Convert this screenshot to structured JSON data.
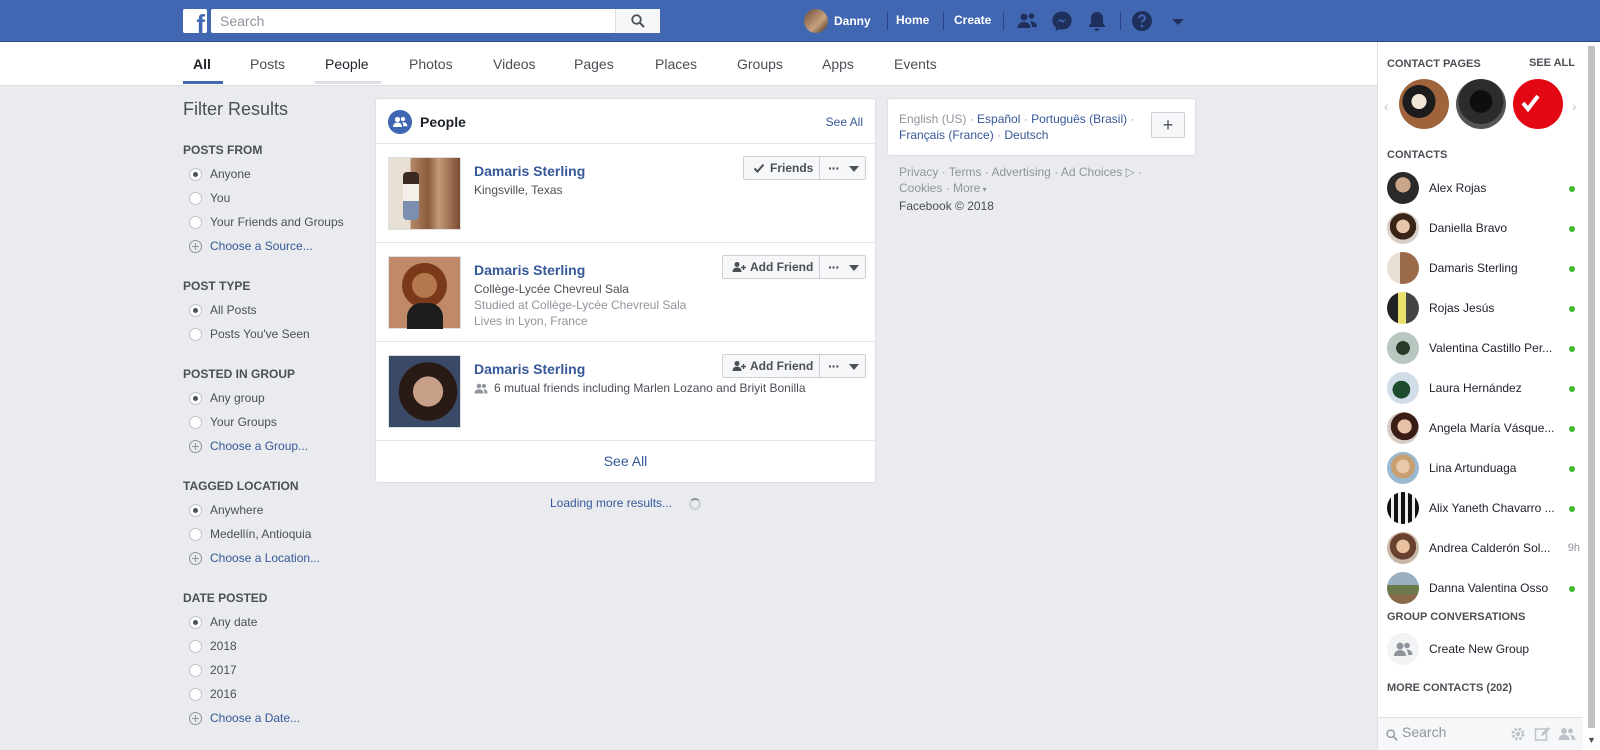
{
  "topbar": {
    "logo": "f",
    "search_placeholder": "Search",
    "user_name": "Danny",
    "home": "Home",
    "create": "Create"
  },
  "tabs": [
    "All",
    "Posts",
    "People",
    "Photos",
    "Videos",
    "Pages",
    "Places",
    "Groups",
    "Apps",
    "Events"
  ],
  "filter": {
    "title": "Filter Results",
    "posts_from": {
      "heading": "POSTS FROM",
      "options": [
        "Anyone",
        "You",
        "Your Friends and Groups"
      ],
      "selected": "Anyone",
      "link": "Choose a Source..."
    },
    "post_type": {
      "heading": "POST TYPE",
      "options": [
        "All Posts",
        "Posts You've Seen"
      ],
      "selected": "All Posts"
    },
    "posted_in_group": {
      "heading": "POSTED IN GROUP",
      "options": [
        "Any group",
        "Your Groups"
      ],
      "selected": "Any group",
      "link": "Choose a Group..."
    },
    "tagged_location": {
      "heading": "TAGGED LOCATION",
      "options": [
        "Anywhere",
        "Medellín, Antioquia"
      ],
      "selected": "Anywhere",
      "link": "Choose a Location..."
    },
    "date_posted": {
      "heading": "DATE POSTED",
      "options": [
        "Any date",
        "2018",
        "2017",
        "2016"
      ],
      "selected": "Any date",
      "link": "Choose a Date..."
    }
  },
  "people": {
    "title": "People",
    "see_all": "See All",
    "results": [
      {
        "name": "Damaris Sterling",
        "lines": [
          "Kingsville, Texas"
        ],
        "action": "Friends"
      },
      {
        "name": "Damaris Sterling",
        "lines": [
          "Collège-Lycée Chevreul Sala",
          "Studied at Collège-Lycée Chevreul Sala",
          "Lives in Lyon, France"
        ],
        "action": "Add Friend"
      },
      {
        "name": "Damaris Sterling",
        "lines": [
          "6 mutual friends including Marlen Lozano and Briyit Bonilla"
        ],
        "action": "Add Friend"
      }
    ],
    "footer": "See All",
    "loading": "Loading more results..."
  },
  "languages": {
    "current": "English (US)",
    "others": [
      "Español",
      "Português (Brasil)",
      "Français (France)",
      "Deutsch"
    ],
    "add": "+"
  },
  "legal": {
    "links": [
      "Privacy",
      "Terms",
      "Advertising",
      "Ad Choices",
      "Cookies",
      "More"
    ],
    "copyright": "Facebook © 2018"
  },
  "chat": {
    "contact_pages": "CONTACT PAGES",
    "see_all": "SEE ALL",
    "contacts_heading": "CONTACTS",
    "contacts": [
      {
        "name": "Alex Rojas",
        "status": "online"
      },
      {
        "name": "Daniella Bravo",
        "status": "online"
      },
      {
        "name": "Damaris Sterling",
        "status": "online"
      },
      {
        "name": "Rojas Jesús",
        "status": "online"
      },
      {
        "name": "Valentina Castillo Per...",
        "status": "online"
      },
      {
        "name": "Laura Hernández",
        "status": "online"
      },
      {
        "name": "Angela María Vásque...",
        "status": "online"
      },
      {
        "name": "Lina Artunduaga",
        "status": "online"
      },
      {
        "name": "Alix Yaneth Chavarro ...",
        "status": "online"
      },
      {
        "name": "Andrea Calderón Sol...",
        "status": "9h"
      },
      {
        "name": "Danna Valentina Osso",
        "status": "online"
      }
    ],
    "group_conversations": "GROUP CONVERSATIONS",
    "create_group": "Create New Group",
    "more_contacts": "MORE CONTACTS (202)",
    "search_placeholder": "Search"
  },
  "colors": {
    "brand": "#4267b2",
    "link": "#365899",
    "online": "#42b72a",
    "page_bg": "#e9ebee"
  }
}
